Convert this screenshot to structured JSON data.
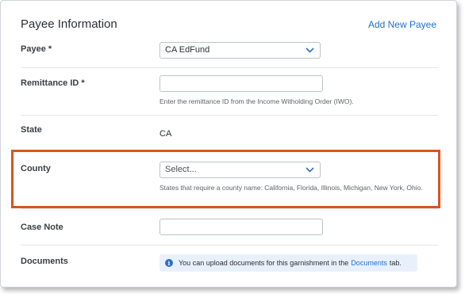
{
  "section": {
    "title": "Payee Information",
    "add_link": "Add New Payee"
  },
  "payee": {
    "label": "Payee *",
    "value": "CA EdFund"
  },
  "remittance": {
    "label": "Remittance ID *",
    "value": "",
    "help": "Enter the remittance ID from the Income Witholding Order (IWO)."
  },
  "state": {
    "label": "State",
    "value": "CA"
  },
  "county": {
    "label": "County",
    "placeholder": "Select...",
    "help": "States that require a county name: California, Florida, Illinois, Michigan, New York, Ohio."
  },
  "case_note": {
    "label": "Case Note",
    "value": ""
  },
  "documents": {
    "label": "Documents",
    "info_before": "You can upload documents for this garnishment in the",
    "info_link": "Documents",
    "info_after": "tab."
  },
  "colors": {
    "accent": "#1f6fd1",
    "highlight": "#d9541e",
    "info_bg": "#e8f1fb"
  },
  "icons": {
    "select_arrow": "chevron-down-icon",
    "info": "info-icon"
  }
}
